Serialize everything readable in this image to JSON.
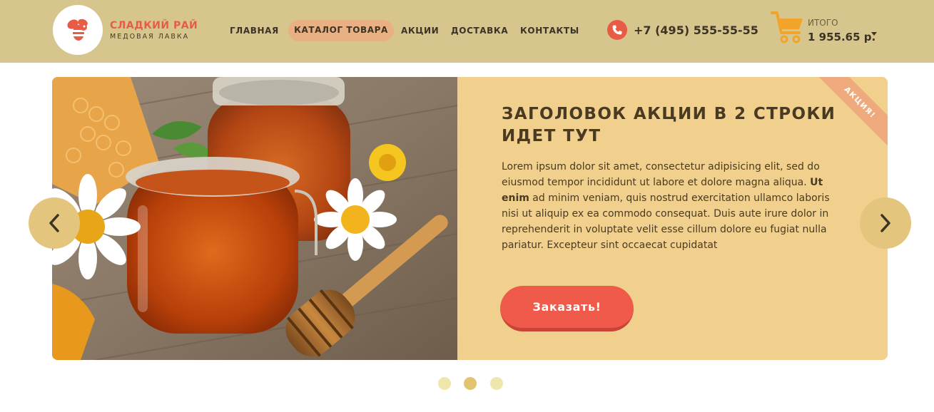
{
  "logo": {
    "title": "СЛАДКИЙ РАЙ",
    "subtitle": "МЕДОВАЯ ЛАВКА",
    "icon": "bee-icon"
  },
  "nav": {
    "items": [
      "ГЛАВНАЯ",
      "КАТАЛОГ ТОВАРА",
      "АКЦИИ",
      "ДОСТАВКА",
      "КОНТАКТЫ"
    ],
    "active_index": 1
  },
  "contact": {
    "phone": "+7 (495) 555-55-55",
    "icon": "phone-icon"
  },
  "cart": {
    "label": "ИТОГО",
    "total": "1 955.65 р.",
    "icon": "cart-icon"
  },
  "slide": {
    "badge": "АКЦИЯ!",
    "title": "ЗАГОЛОВОК АКЦИИ В 2 СТРОКИ ИДЕТ ТУТ",
    "text_before": "Lorem ipsum dolor sit amet, consectetur adipisicing elit, sed do eiusmod tempor incididunt ut labore et dolore magna aliqua. ",
    "text_bold": "Ut enim",
    "text_after": " ad minim veniam, quis nostrud exercitation ullamco laboris nisi ut aliquip ex ea commodo consequat. Duis aute irure dolor in reprehenderit in voluptate velit esse cillum dolore eu fugiat nulla pariatur. Excepteur sint occaecat cupidatat",
    "button": "Заказать!",
    "image": "honey-jars-photo"
  },
  "slider": {
    "prev_icon": "chevron-left-icon",
    "next_icon": "chevron-right-icon",
    "dots_count": 3,
    "active_dot": 1
  },
  "colors": {
    "header_bg": "#d6c68e",
    "accent_red": "#e85c45",
    "panel_bg": "#f0d08c",
    "badge_bg": "#eea97c",
    "arrow_bg": "#e3c57e"
  }
}
